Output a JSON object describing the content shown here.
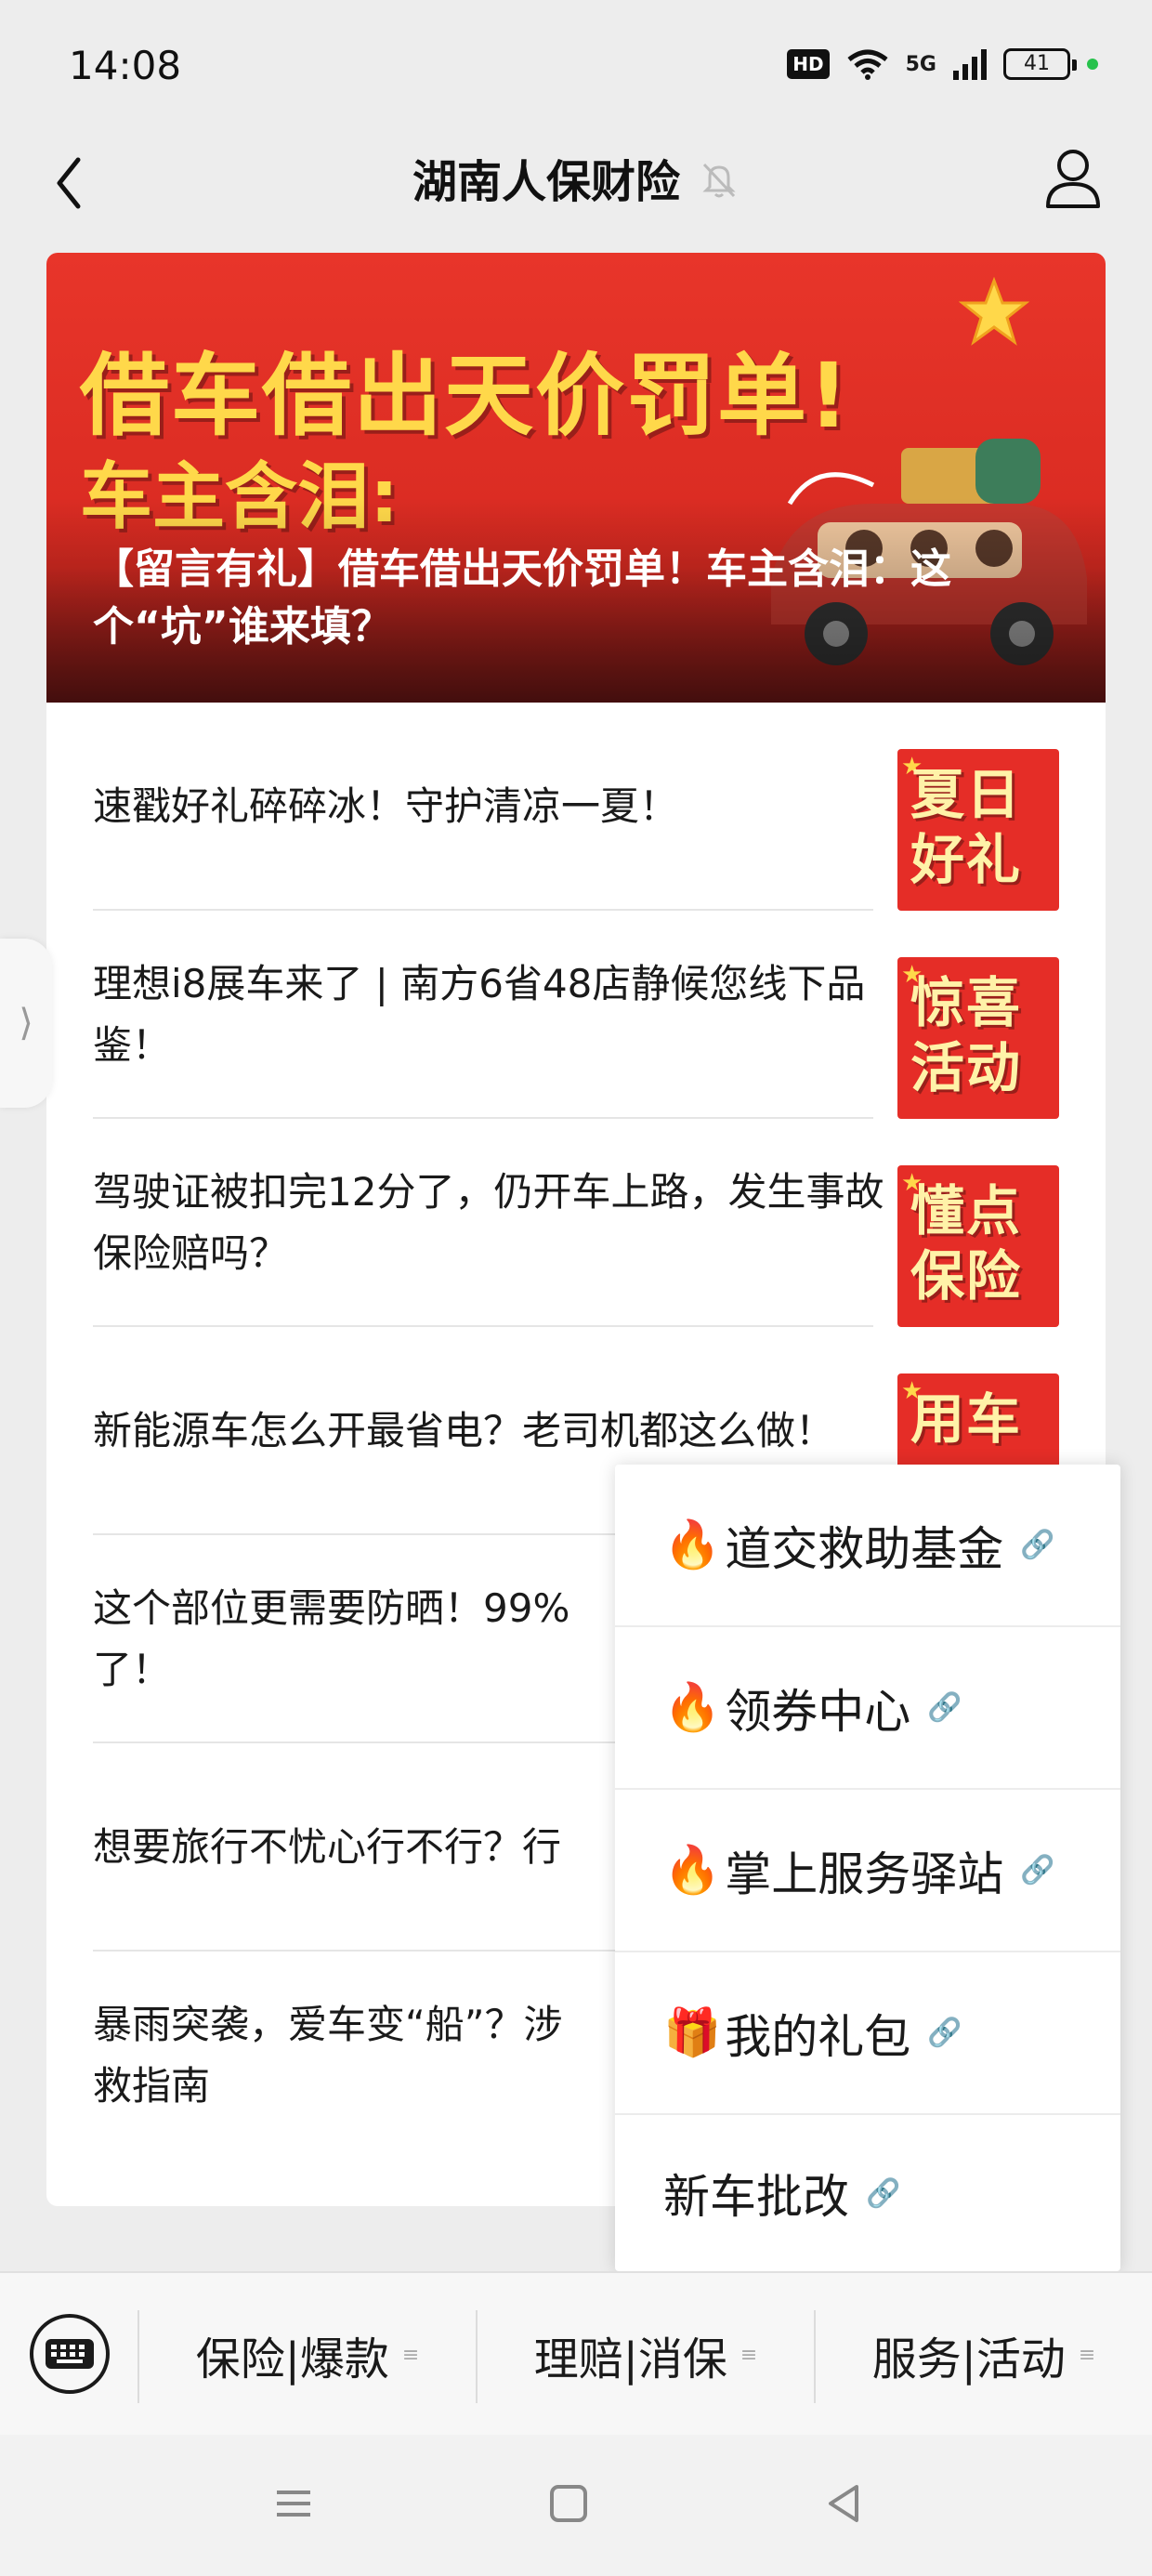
{
  "status_bar": {
    "time": "14:08",
    "hd": "HD",
    "network": "5G",
    "battery": "41"
  },
  "header": {
    "title": "湖南人保财险"
  },
  "featured": {
    "banner_line1": "借车借出天价罚单!",
    "banner_line2": "车主含泪:",
    "caption": "【留言有礼】借车借出天价罚单！车主含泪：这个“坑”谁来填？"
  },
  "articles": [
    {
      "title": "速戳好礼碎碎冰！守护清凉一夏！",
      "thumb": "夏日好礼"
    },
    {
      "title": "理想i8展车来了 | 南方6省48店静候您线下品鉴！",
      "thumb": "惊喜活动"
    },
    {
      "title": "驾驶证被扣完12分了，仍开车上路，发生事故保险赔吗？",
      "thumb": "懂点保险"
    },
    {
      "title": "新能源车怎么开最省电？老司机都这么做！",
      "thumb": "用车"
    },
    {
      "title": "这个部位更需要防晒！99%",
      "title2": "了！",
      "thumb": ""
    },
    {
      "title": "想要旅行不忧心行不行？行",
      "thumb": ""
    },
    {
      "title": "暴雨突袭，爱车变“船”？涉",
      "title2": "救指南",
      "thumb": ""
    }
  ],
  "popup_menu": [
    {
      "emoji": "🔥",
      "label": "道交救助基金"
    },
    {
      "emoji": "🔥",
      "label": "领券中心"
    },
    {
      "emoji": "🔥",
      "label": "掌上服务驿站"
    },
    {
      "emoji": "🎁",
      "label": "我的礼包"
    },
    {
      "emoji": "",
      "label": "新车批改"
    }
  ],
  "bottom_tabs": [
    {
      "label": "保险|爆款"
    },
    {
      "label": "理赔|消保"
    },
    {
      "label": "服务|活动"
    }
  ],
  "colors": {
    "accent_red": "#e52d27",
    "banner_yellow": "#ffd84a",
    "page_bg": "#ededed"
  }
}
